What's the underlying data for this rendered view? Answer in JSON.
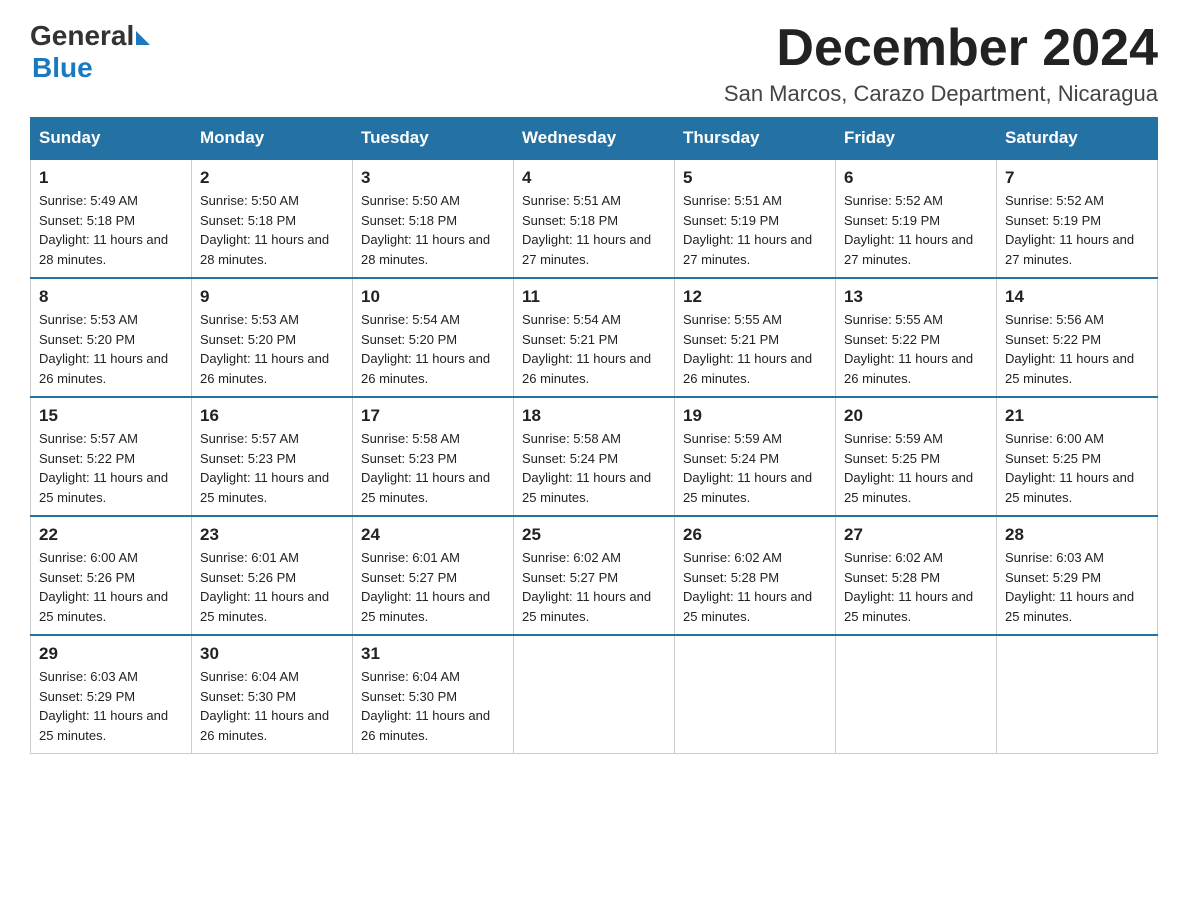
{
  "header": {
    "logo_general": "General",
    "logo_blue": "Blue",
    "month_title": "December 2024",
    "location": "San Marcos, Carazo Department, Nicaragua"
  },
  "days_of_week": [
    "Sunday",
    "Monday",
    "Tuesday",
    "Wednesday",
    "Thursday",
    "Friday",
    "Saturday"
  ],
  "weeks": [
    [
      {
        "day": "1",
        "sunrise": "5:49 AM",
        "sunset": "5:18 PM",
        "daylight": "11 hours and 28 minutes."
      },
      {
        "day": "2",
        "sunrise": "5:50 AM",
        "sunset": "5:18 PM",
        "daylight": "11 hours and 28 minutes."
      },
      {
        "day": "3",
        "sunrise": "5:50 AM",
        "sunset": "5:18 PM",
        "daylight": "11 hours and 28 minutes."
      },
      {
        "day": "4",
        "sunrise": "5:51 AM",
        "sunset": "5:18 PM",
        "daylight": "11 hours and 27 minutes."
      },
      {
        "day": "5",
        "sunrise": "5:51 AM",
        "sunset": "5:19 PM",
        "daylight": "11 hours and 27 minutes."
      },
      {
        "day": "6",
        "sunrise": "5:52 AM",
        "sunset": "5:19 PM",
        "daylight": "11 hours and 27 minutes."
      },
      {
        "day": "7",
        "sunrise": "5:52 AM",
        "sunset": "5:19 PM",
        "daylight": "11 hours and 27 minutes."
      }
    ],
    [
      {
        "day": "8",
        "sunrise": "5:53 AM",
        "sunset": "5:20 PM",
        "daylight": "11 hours and 26 minutes."
      },
      {
        "day": "9",
        "sunrise": "5:53 AM",
        "sunset": "5:20 PM",
        "daylight": "11 hours and 26 minutes."
      },
      {
        "day": "10",
        "sunrise": "5:54 AM",
        "sunset": "5:20 PM",
        "daylight": "11 hours and 26 minutes."
      },
      {
        "day": "11",
        "sunrise": "5:54 AM",
        "sunset": "5:21 PM",
        "daylight": "11 hours and 26 minutes."
      },
      {
        "day": "12",
        "sunrise": "5:55 AM",
        "sunset": "5:21 PM",
        "daylight": "11 hours and 26 minutes."
      },
      {
        "day": "13",
        "sunrise": "5:55 AM",
        "sunset": "5:22 PM",
        "daylight": "11 hours and 26 minutes."
      },
      {
        "day": "14",
        "sunrise": "5:56 AM",
        "sunset": "5:22 PM",
        "daylight": "11 hours and 25 minutes."
      }
    ],
    [
      {
        "day": "15",
        "sunrise": "5:57 AM",
        "sunset": "5:22 PM",
        "daylight": "11 hours and 25 minutes."
      },
      {
        "day": "16",
        "sunrise": "5:57 AM",
        "sunset": "5:23 PM",
        "daylight": "11 hours and 25 minutes."
      },
      {
        "day": "17",
        "sunrise": "5:58 AM",
        "sunset": "5:23 PM",
        "daylight": "11 hours and 25 minutes."
      },
      {
        "day": "18",
        "sunrise": "5:58 AM",
        "sunset": "5:24 PM",
        "daylight": "11 hours and 25 minutes."
      },
      {
        "day": "19",
        "sunrise": "5:59 AM",
        "sunset": "5:24 PM",
        "daylight": "11 hours and 25 minutes."
      },
      {
        "day": "20",
        "sunrise": "5:59 AM",
        "sunset": "5:25 PM",
        "daylight": "11 hours and 25 minutes."
      },
      {
        "day": "21",
        "sunrise": "6:00 AM",
        "sunset": "5:25 PM",
        "daylight": "11 hours and 25 minutes."
      }
    ],
    [
      {
        "day": "22",
        "sunrise": "6:00 AM",
        "sunset": "5:26 PM",
        "daylight": "11 hours and 25 minutes."
      },
      {
        "day": "23",
        "sunrise": "6:01 AM",
        "sunset": "5:26 PM",
        "daylight": "11 hours and 25 minutes."
      },
      {
        "day": "24",
        "sunrise": "6:01 AM",
        "sunset": "5:27 PM",
        "daylight": "11 hours and 25 minutes."
      },
      {
        "day": "25",
        "sunrise": "6:02 AM",
        "sunset": "5:27 PM",
        "daylight": "11 hours and 25 minutes."
      },
      {
        "day": "26",
        "sunrise": "6:02 AM",
        "sunset": "5:28 PM",
        "daylight": "11 hours and 25 minutes."
      },
      {
        "day": "27",
        "sunrise": "6:02 AM",
        "sunset": "5:28 PM",
        "daylight": "11 hours and 25 minutes."
      },
      {
        "day": "28",
        "sunrise": "6:03 AM",
        "sunset": "5:29 PM",
        "daylight": "11 hours and 25 minutes."
      }
    ],
    [
      {
        "day": "29",
        "sunrise": "6:03 AM",
        "sunset": "5:29 PM",
        "daylight": "11 hours and 25 minutes."
      },
      {
        "day": "30",
        "sunrise": "6:04 AM",
        "sunset": "5:30 PM",
        "daylight": "11 hours and 26 minutes."
      },
      {
        "day": "31",
        "sunrise": "6:04 AM",
        "sunset": "5:30 PM",
        "daylight": "11 hours and 26 minutes."
      },
      null,
      null,
      null,
      null
    ]
  ]
}
